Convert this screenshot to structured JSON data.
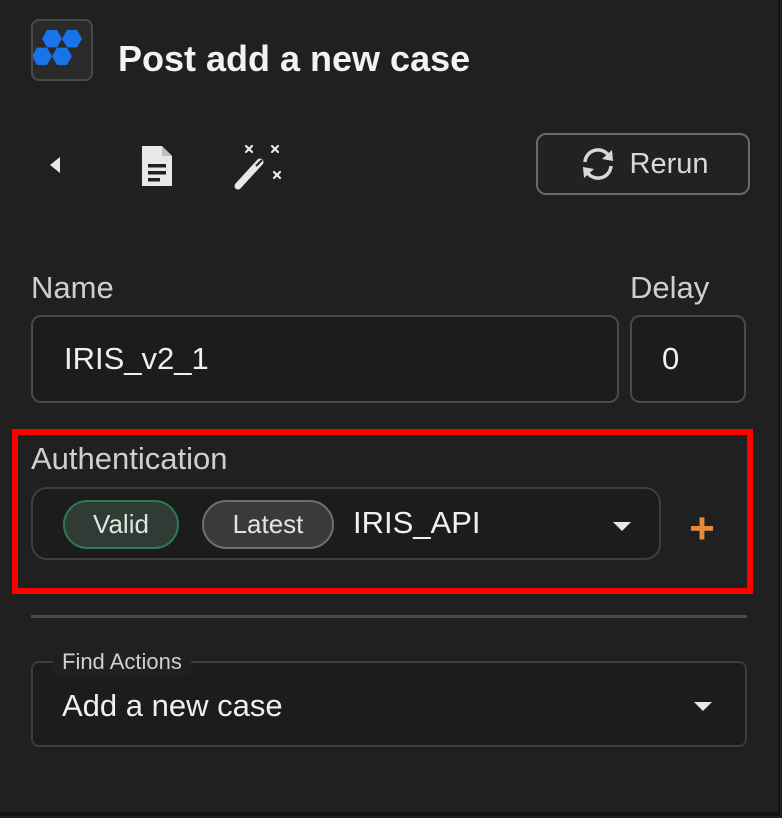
{
  "header": {
    "title": "Post add a new case",
    "logo_icon": "hexagon-cluster-icon",
    "logo_color": "#1a73e8"
  },
  "toolbar": {
    "back_icon": "caret-left-icon",
    "doc_icon": "document-icon",
    "magic_icon": "magic-wand-icon",
    "rerun_label": "Rerun",
    "rerun_icon": "refresh-icon"
  },
  "form": {
    "name_label": "Name",
    "name_value": "IRIS_v2_1",
    "delay_label": "Delay",
    "delay_value": "0",
    "auth_label": "Authentication",
    "auth_chip_valid": "Valid",
    "auth_chip_latest": "Latest",
    "auth_value": "IRIS_API",
    "add_auth_symbol": "+"
  },
  "find_actions": {
    "label": "Find Actions",
    "value": "Add a new case"
  },
  "colors": {
    "background": "#202020",
    "highlight": "#ff0000",
    "accent_orange": "#e88a3c",
    "valid_green": "#2f7a52"
  }
}
